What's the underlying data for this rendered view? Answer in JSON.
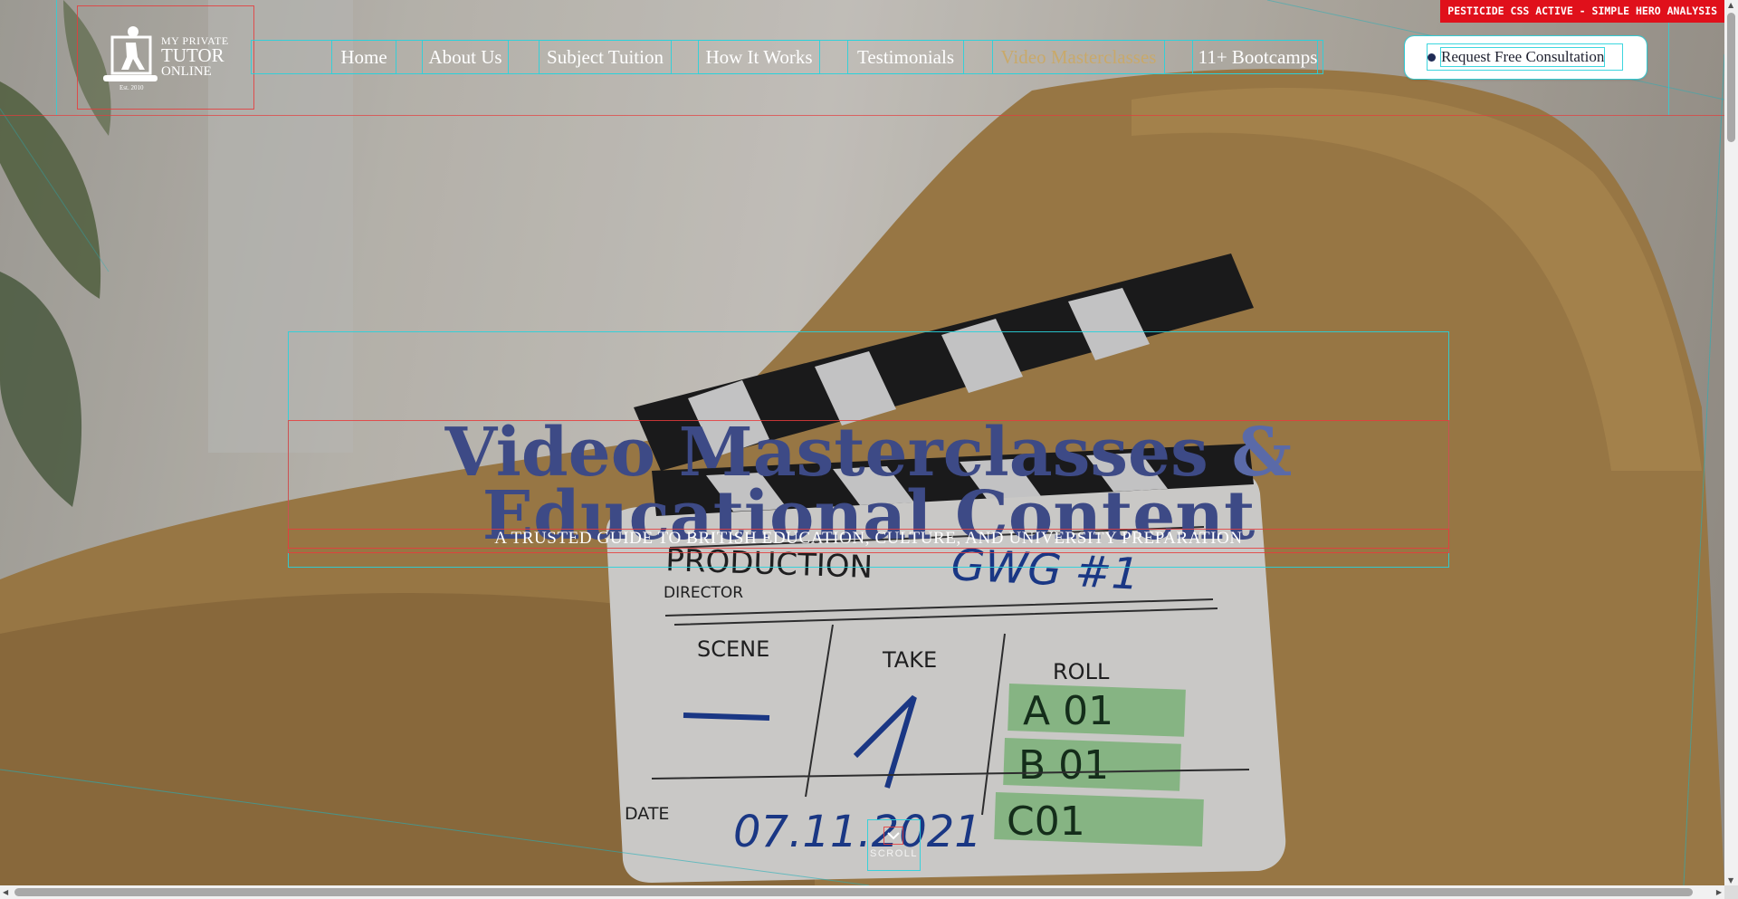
{
  "header": {
    "logo": {
      "line1": "MY PRIVATE",
      "line2": "TUTOR",
      "line3": "ONLINE",
      "est": "Est. 2010"
    },
    "nav": [
      {
        "label": "Home"
      },
      {
        "label": "About Us"
      },
      {
        "label": "Subject Tuition"
      },
      {
        "label": "How It Works"
      },
      {
        "label": "Testimonials"
      },
      {
        "label": "Video Masterclasses",
        "active": true
      },
      {
        "label": "11+ Bootcamps"
      }
    ],
    "cta_label": "Request Free Consultation"
  },
  "badge": "PESTICIDE CSS ACTIVE - SIMPLE HERO ANALYSIS",
  "hero": {
    "title_part1": "Video Masterclasses",
    "title_amp": "&",
    "title_part2": "Educational Content",
    "subtitle": "A TRUSTED GUIDE TO BRITISH EDUCATION, CULTURE, AND UNIVERSITY PREPARATION",
    "scroll_label": "SCROLL"
  },
  "colors": {
    "title": "#3d4a86",
    "active_nav": "#c9a96a",
    "badge": "#e0101b",
    "outline_red": "#e63c3c",
    "outline_cyan": "#28d2dc"
  },
  "icons": [
    "logo-icon",
    "chevron-down-icon",
    "dot-icon"
  ]
}
